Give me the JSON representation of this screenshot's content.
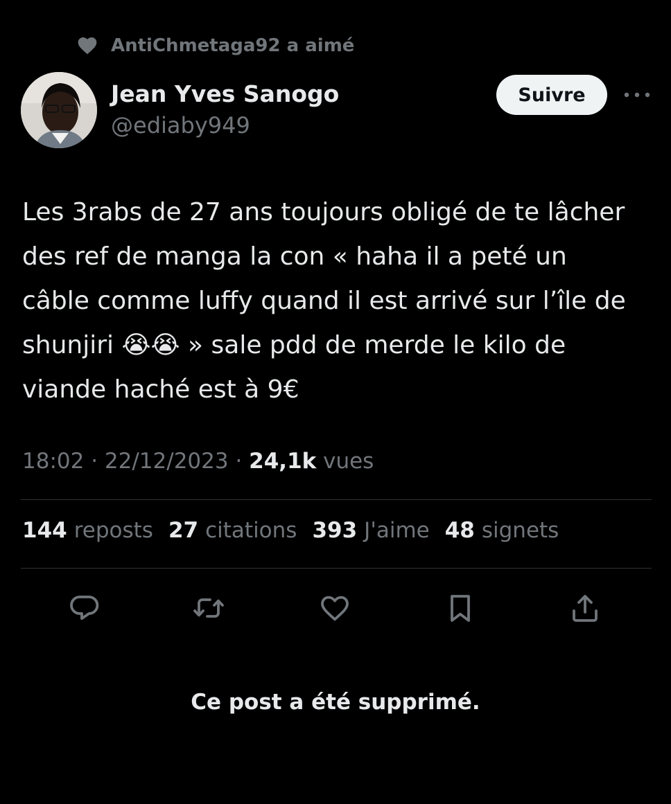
{
  "social_context": {
    "icon": "heart-filled-icon",
    "text": "AntiChmetaga92 a aimé"
  },
  "author": {
    "display_name": "Jean Yves Sanogo",
    "handle": "@ediaby949",
    "avatar": "avatar-photo"
  },
  "follow_button": {
    "label": "Suivre"
  },
  "more_button": {
    "icon": "more-dots-icon"
  },
  "tweet": {
    "lines": [
      "Les 3rabs de 27 ans toujours obligé de te lâcher",
      "des ref de manga la con « haha il a peté un",
      "câble comme luffy quand il est arrivé sur l’île de",
      "shunjiri 😭😭 » sale pdd de merde le kilo de",
      "viande haché est à 9€"
    ]
  },
  "meta": {
    "time": "18:02",
    "separator": " · ",
    "date": "22/12/2023",
    "views_count": "24,1k",
    "views_label": " vues"
  },
  "stats": {
    "reposts": {
      "value": "144",
      "label": "reposts"
    },
    "quotes": {
      "value": "27",
      "label": "citations"
    },
    "likes": {
      "value": "393",
      "label": "J'aime"
    },
    "bookmarks": {
      "value": "48",
      "label": "signets"
    }
  },
  "actions": {
    "reply": "reply-icon",
    "repost": "repost-icon",
    "like": "heart-outline-icon",
    "bookmark": "bookmark-icon",
    "share": "share-icon"
  },
  "notice": {
    "text": "Ce post a été supprimé."
  },
  "colors": {
    "background": "#000000",
    "primary_text": "#e7e9ea",
    "secondary_text": "#71767b",
    "divider": "#2f3336",
    "follow_button_bg": "#eff3f4"
  }
}
